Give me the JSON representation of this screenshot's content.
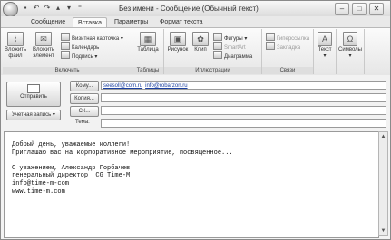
{
  "window": {
    "title": "Без имени - Сообщение (Обычный текст)",
    "controls": [
      "–",
      "□",
      "✕"
    ]
  },
  "quick_access": [
    "save-icon",
    "undo-icon",
    "redo-icon",
    "arrow-up-icon",
    "arrow-down-icon",
    "dropdown-icon"
  ],
  "tabs": [
    {
      "label": "Сообщение",
      "active": false
    },
    {
      "label": "Вставка",
      "active": true
    },
    {
      "label": "Параметры",
      "active": false
    },
    {
      "label": "Формат текста",
      "active": false
    }
  ],
  "ribbon": {
    "include": {
      "label": "Включить",
      "attach_file": "Вложить файл",
      "attach_item": "Вложить элемент",
      "business_card": "Визитная карточка",
      "calendar": "Календарь",
      "signature": "Подпись"
    },
    "tables": {
      "label": "Таблицы",
      "table": "Таблица"
    },
    "illustrations": {
      "label": "Иллюстрации",
      "picture": "Рисунок",
      "clip": "Клип",
      "shapes": "Фигуры",
      "smartart": "SmartArt",
      "chart": "Диаграмма"
    },
    "links": {
      "label": "Связи",
      "hyperlink": "Гиперссылка",
      "bookmark": "Закладка"
    },
    "text": {
      "label": "Текст"
    },
    "symbols": {
      "label": "Символы"
    }
  },
  "compose": {
    "send": "Отправить",
    "account": "Учетная запись",
    "to_button": "Кому...",
    "cc_button": "Копия...",
    "bcc_button": "СК...",
    "subject_label": "Тема:",
    "to_recipients": [
      "seesoll@com.ru",
      "info@robarzon.ru"
    ],
    "cc_value": "",
    "bcc_value": "",
    "subject_value": ""
  },
  "body_lines": [
    "Добрый день, уважаемые коллеги!",
    "Приглашаю вас на корпоративное мероприятие, посвященное...",
    "",
    "С уважением, Александр Горбачев",
    "генеральный директор  CG Time-M",
    "info@time-m-com",
    "www.time-m.com"
  ]
}
